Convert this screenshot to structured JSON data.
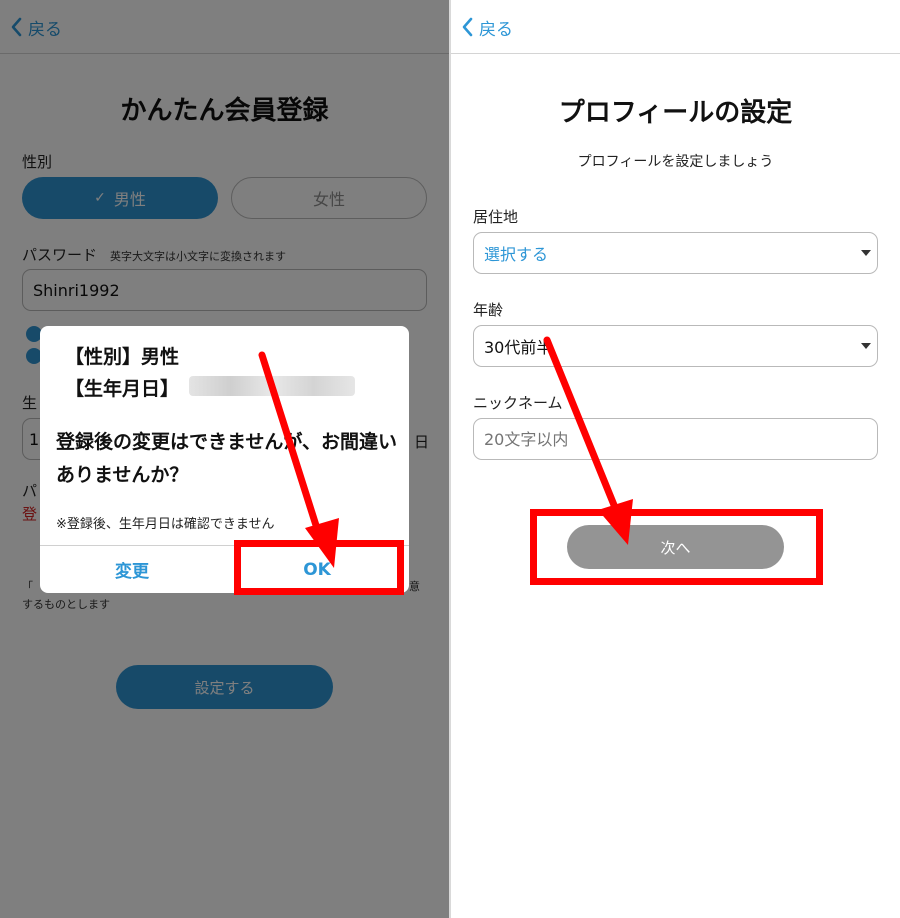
{
  "left": {
    "back_label": "戻る",
    "title": "かんたん会員登録",
    "gender_label": "性別",
    "gender_male": "男性",
    "gender_female": "女性",
    "gender_check": "✓",
    "password_label": "パスワード",
    "password_note": "英字大文字は小文字に変換されます",
    "password_value": "Shinri1992",
    "dob_label_partial": "生",
    "dob_field_partial": "1",
    "dob_suffix": "日",
    "pa_partial": "パ",
    "red_partial": "登",
    "consent_line1_partial": "「",
    "consent_line1_end": "意",
    "consent_line2": "するものとします",
    "submit_label": "設定する",
    "dialog": {
      "line1": "【性別】男性",
      "line2": "【生年月日】",
      "message": "登録後の変更はできませんが、お間違いありませんか？",
      "note": "※登録後、生年月日は確認できません",
      "change_button": "変更",
      "ok_button": "OK"
    }
  },
  "right": {
    "back_label": "戻る",
    "title": "プロフィールの設定",
    "subtitle": "プロフィールを設定しましょう",
    "residence_label": "居住地",
    "residence_value": "選択する",
    "age_label": "年齢",
    "age_value": "30代前半",
    "nickname_label": "ニックネーム",
    "nickname_placeholder": "20文字以内",
    "next_button": "次へ"
  },
  "colors": {
    "accent": "#2f95d3",
    "link": "#2d96d6",
    "annotation": "#ff0000",
    "next_button": "#949494"
  }
}
